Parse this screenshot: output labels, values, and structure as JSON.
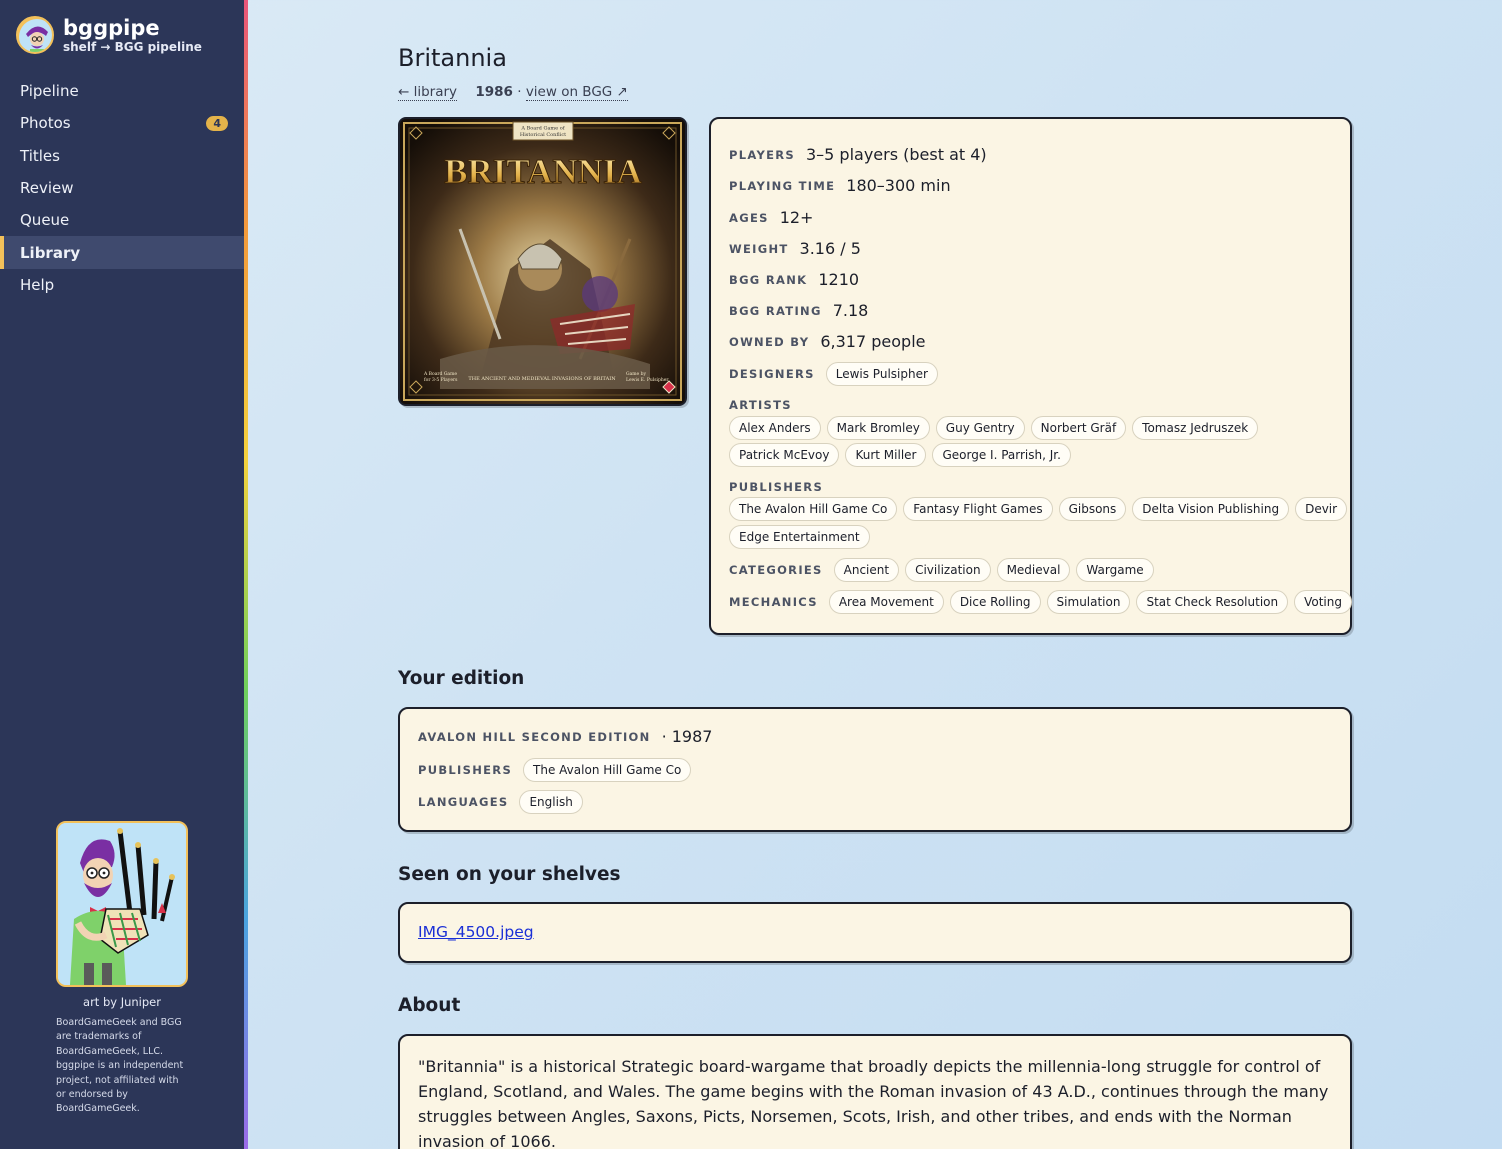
{
  "app": {
    "name": "bggpipe",
    "subtitle": "shelf → BGG pipeline"
  },
  "nav": [
    {
      "label": "Pipeline",
      "active": false
    },
    {
      "label": "Photos",
      "active": false,
      "badge": "4"
    },
    {
      "label": "Titles",
      "active": false
    },
    {
      "label": "Review",
      "active": false
    },
    {
      "label": "Queue",
      "active": false
    },
    {
      "label": "Library",
      "active": true
    },
    {
      "label": "Help",
      "active": false
    }
  ],
  "sidebar_footer": {
    "art_credit": "art by Juniper",
    "disclaimer": "BoardGameGeek and BGG are trademarks of BoardGameGeek, LLC. bggpipe is an independent project, not affiliated with or endorsed by BoardGameGeek."
  },
  "game": {
    "title": "Britannia",
    "back_link": "← library",
    "year": "1986",
    "separator": "·",
    "bgg_link": "view on BGG ↗",
    "cover": {
      "banner": "A Board Game of Historical Conflict",
      "title": "BRITANNIA",
      "bottom_left": "A Board Game for 3-5 Players",
      "bottom_center": "THE ANCIENT AND MEDIEVAL INVASIONS OF BRITAIN",
      "bottom_right": "Game by Lewis E. Pulsipher"
    },
    "details": {
      "players_label": "PLAYERS",
      "players": "3–5 players (best at 4)",
      "time_label": "PLAYING TIME",
      "time": "180–300 min",
      "ages_label": "AGES",
      "ages": "12+",
      "weight_label": "WEIGHT",
      "weight": "3.16 / 5",
      "rank_label": "BGG RANK",
      "rank": "1210",
      "rating_label": "BGG RATING",
      "rating": "7.18",
      "owned_label": "OWNED BY",
      "owned": "6,317 people",
      "designers_label": "DESIGNERS",
      "designers": [
        "Lewis Pulsipher"
      ],
      "artists_label": "ARTISTS",
      "artists_row1": [
        "Alex Anders",
        "Mark Bromley",
        "Guy Gentry",
        "Norbert Gräf",
        "Tomasz Jedruszek"
      ],
      "artists_row2": [
        "Patrick McEvoy",
        "Kurt Miller",
        "George I. Parrish, Jr."
      ],
      "publishers_label": "PUBLISHERS",
      "publishers_row1": [
        "The Avalon Hill Game Co",
        "Fantasy Flight Games",
        "Gibsons",
        "Delta Vision Publishing",
        "Devir"
      ],
      "publishers_row2": [
        "Edge Entertainment"
      ],
      "categories_label": "CATEGORIES",
      "categories": [
        "Ancient",
        "Civilization",
        "Medieval",
        "Wargame"
      ],
      "mechanics_label": "MECHANICS",
      "mechanics": [
        "Area Movement",
        "Dice Rolling",
        "Simulation",
        "Stat Check Resolution",
        "Voting"
      ]
    }
  },
  "edition": {
    "heading": "Your edition",
    "name": "AVALON HILL SECOND EDITION",
    "year": "· 1987",
    "publishers_label": "PUBLISHERS",
    "publishers": [
      "The Avalon Hill Game Co"
    ],
    "languages_label": "LANGUAGES",
    "languages": [
      "English"
    ]
  },
  "shelves": {
    "heading": "Seen on your shelves",
    "file": "IMG_4500.jpeg"
  },
  "about": {
    "heading": "About",
    "text": "\"Britannia\" is a historical Strategic board-wargame that broadly depicts the millennia-long struggle for control of England, Scotland, and Wales. The game begins with the Roman invasion of 43 A.D., continues through the many struggles between Angles, Saxons, Picts, Norsemen, Scots, Irish, and other tribes, and ends with the Norman invasion of 1066."
  },
  "colors": {
    "sidebar": "#2c3658",
    "accent": "#f3c15a",
    "card": "#fbf5e4",
    "link": "#1a2fd6"
  }
}
